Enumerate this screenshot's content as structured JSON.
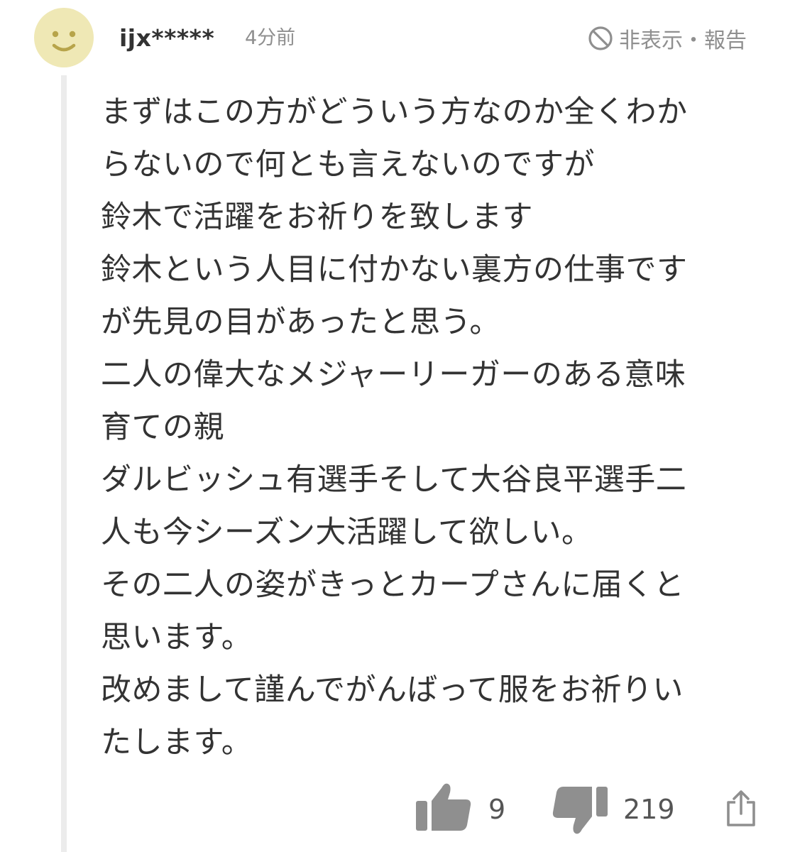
{
  "comment": {
    "username": "ijx*****",
    "time": "4分前",
    "report_label": "非表示・報告",
    "body_lines": [
      "まずはこの方がどういう方なのか全くわか",
      "らないので何とも言えないのですが",
      "鈴木で活躍をお祈りを致します",
      "鈴木という人目に付かない裏方の仕事です",
      "が先見の目があったと思う。",
      "二人の偉大なメジャーリーガーのある意味",
      "育ての親",
      "ダルビッシュ有選手そして大谷良平選手二",
      "人も今シーズン大活躍して欲しい。",
      "その二人の姿がきっとカープさんに届くと",
      "思います。",
      "改めまして謹んでがんばって服をお祈りい",
      "たします。"
    ],
    "likes": "9",
    "dislikes": "219"
  },
  "icons": {
    "avatar": "smiley-face-avatar",
    "report": "prohibit-icon",
    "like": "thumbs-up-icon",
    "dislike": "thumbs-down-icon",
    "share": "share-icon"
  },
  "colors": {
    "avatar_bg": "#efe8b5",
    "avatar_face": "#b7a44a",
    "icon_gray": "#8f8f8f",
    "text": "#333333"
  }
}
